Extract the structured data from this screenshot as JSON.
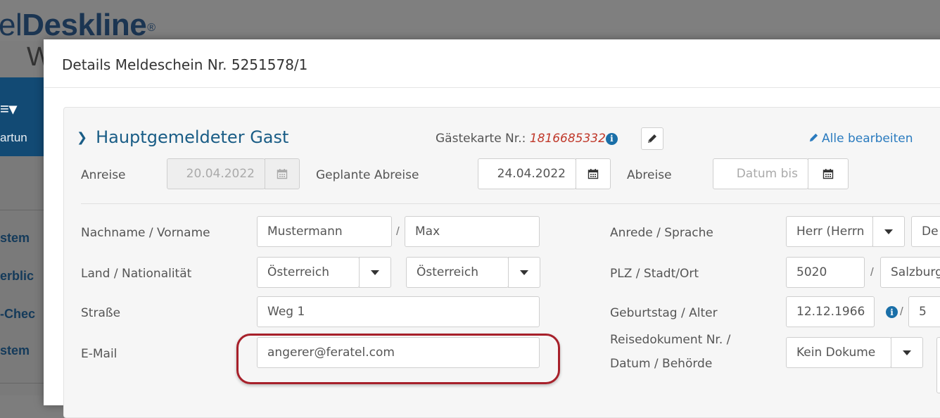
{
  "background": {
    "logo_prefix": "el",
    "logo_brand": "Deskline",
    "logo_reg": "®",
    "logo_sub": "W",
    "nav_icon": "≡▾",
    "nav_text": "artun",
    "menu_items": [
      "stem",
      "erblic",
      "-Chec",
      "stem"
    ]
  },
  "modal": {
    "title": "Details Meldeschein Nr. 5251578/1"
  },
  "section": {
    "heading": "Hauptgemeldeter Gast",
    "card_label": "Gästekarte Nr.:",
    "card_number": "1816685332",
    "edit_all": "Alle bearbeiten"
  },
  "dates": {
    "arrival_label": "Anreise",
    "arrival_value": "20.04.2022",
    "planned_departure_label": "Geplante Abreise",
    "planned_departure_value": "24.04.2022",
    "departure_label": "Abreise",
    "departure_placeholder": "Datum bis"
  },
  "form": {
    "name_label": "Nachname / Vorname",
    "last_name": "Mustermann",
    "first_name": "Max",
    "country_label": "Land / Nationalität",
    "country": "Österreich",
    "nationality": "Österreich",
    "street_label": "Straße",
    "street": "Weg 1",
    "email_label": "E-Mail",
    "email": "angerer@feratel.com",
    "salutation_label": "Anrede / Sprache",
    "salutation": "Herr (Herrn",
    "language": "De",
    "zip_label": "PLZ / Stadt/Ort",
    "zip": "5020",
    "city": "Salzburg",
    "birthday_label": "Geburtstag / Alter",
    "birthday": "12.12.1966",
    "age": "5",
    "document_label_1": "Reisedokument Nr. /",
    "document_label_2": "Datum / Behörde",
    "document": "Kein Dokume"
  },
  "colors": {
    "accent": "#1a5d86",
    "link": "#2a7bbf",
    "card_number": "#c0392b",
    "highlight": "#a7202a"
  }
}
